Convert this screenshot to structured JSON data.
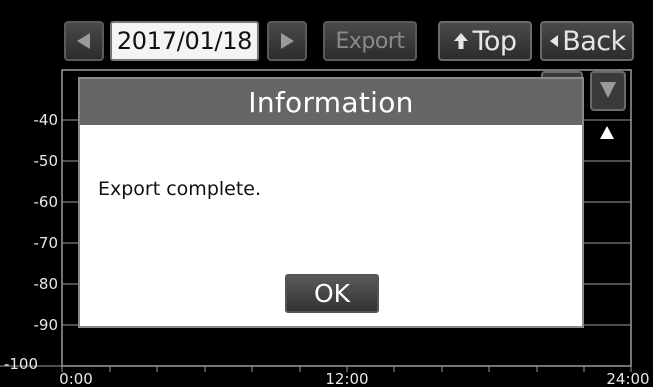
{
  "toolbar": {
    "prev_icon": "triangle-left-icon",
    "date": "2017/01/18",
    "next_icon": "triangle-right-icon",
    "export_label": "Export",
    "top_label": "Top",
    "top_icon": "arrow-up-icon",
    "back_label": "Back",
    "back_icon": "triangle-left-icon"
  },
  "chart": {
    "y_ticks": [
      "-40",
      "-50",
      "-60",
      "-70",
      "-80",
      "-90",
      "-100"
    ],
    "x_ticks": [
      "0:00",
      "12:00",
      "24:00"
    ],
    "scroll_down_icon": "triangle-down-icon",
    "scroll_up_icon": "triangle-up-icon"
  },
  "dialog": {
    "title": "Information",
    "message": "Export complete.",
    "ok_label": "OK"
  },
  "colors": {
    "background": "#000000",
    "dialog_title_bar": "#666666",
    "button_face": "#3a3a3a",
    "disabled_text": "#8a8a8a"
  }
}
